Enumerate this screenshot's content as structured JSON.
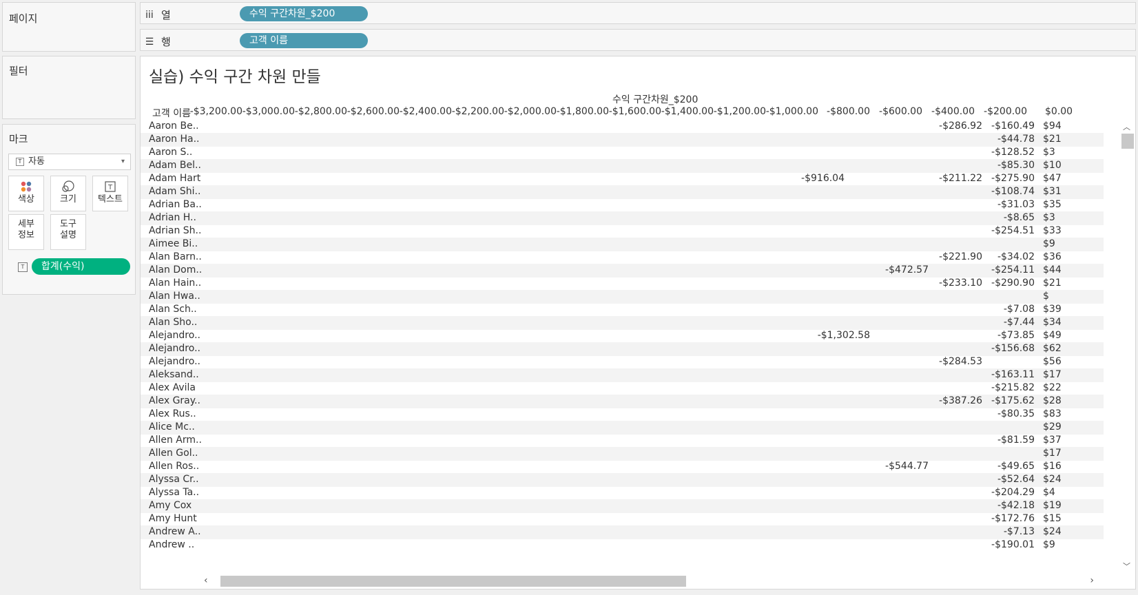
{
  "left_panel": {
    "pages_title": "페이지",
    "filters_title": "필터",
    "marks_title": "마크",
    "mark_type": "자동",
    "buttons": {
      "color": "색상",
      "size": "크기",
      "text": "텍스트",
      "detail_1": "세부",
      "detail_2": "정보",
      "tooltip_1": "도구",
      "tooltip_2": "설명"
    },
    "text_pill": "합계(수익)"
  },
  "shelves": {
    "columns_label": "열",
    "columns_pill": "수익 구간차원_$200",
    "rows_label": "행",
    "rows_pill": "고객 이름"
  },
  "view": {
    "title": "실습) 수익 구간 차원 만들",
    "column_header_title": "수익 구간차원_$200",
    "row_header_label": "고객 이름",
    "columns": [
      "-$3,200.00",
      "-$3,000.00",
      "-$2,800.00",
      "-$2,600.00",
      "-$2,400.00",
      "-$2,200.00",
      "-$2,000.00",
      "-$1,800.00",
      "-$1,600.00",
      "-$1,400.00",
      "-$1,200.00",
      "-$1,000.00",
      "-$800.00",
      "-$600.00",
      "-$400.00",
      "-$200.00",
      "$0.00"
    ],
    "rows": [
      {
        "name": "Aaron Be..",
        "cells": {
          "-$400.00": "-$286.92",
          "-$200.00": "-$160.49",
          "$0.00": "$94"
        }
      },
      {
        "name": "Aaron Ha..",
        "cells": {
          "-$200.00": "-$44.78",
          "$0.00": "$21"
        }
      },
      {
        "name": "Aaron S..",
        "cells": {
          "-$200.00": "-$128.52",
          "$0.00": "$3"
        }
      },
      {
        "name": "Adam Bel..",
        "cells": {
          "-$200.00": "-$85.30",
          "$0.00": "$10"
        }
      },
      {
        "name": "Adam Hart",
        "cells": {
          "-$1,000.00": "-$916.04",
          "-$400.00": "-$211.22",
          "-$200.00": "-$275.90",
          "$0.00": "$47"
        }
      },
      {
        "name": "Adam Shi..",
        "cells": {
          "-$200.00": "-$108.74",
          "$0.00": "$31"
        }
      },
      {
        "name": "Adrian Ba..",
        "cells": {
          "-$200.00": "-$31.03",
          "$0.00": "$35"
        }
      },
      {
        "name": "Adrian H..",
        "cells": {
          "-$200.00": "-$8.65",
          "$0.00": "$3"
        }
      },
      {
        "name": "Adrian Sh..",
        "cells": {
          "-$200.00": "-$254.51",
          "$0.00": "$33"
        }
      },
      {
        "name": "Aimee Bi..",
        "cells": {
          "$0.00": "$9"
        }
      },
      {
        "name": "Alan Barn..",
        "cells": {
          "-$400.00": "-$221.90",
          "-$200.00": "-$34.02",
          "$0.00": "$36"
        }
      },
      {
        "name": "Alan Dom..",
        "cells": {
          "-$600.00": "-$472.57",
          "-$200.00": "-$254.11",
          "$0.00": "$44"
        }
      },
      {
        "name": "Alan Hain..",
        "cells": {
          "-$400.00": "-$233.10",
          "-$200.00": "-$290.90",
          "$0.00": "$21"
        }
      },
      {
        "name": "Alan Hwa..",
        "cells": {
          "$0.00": "$"
        }
      },
      {
        "name": "Alan Sch..",
        "cells": {
          "-$200.00": "-$7.08",
          "$0.00": "$39"
        }
      },
      {
        "name": "Alan Sho..",
        "cells": {
          "-$200.00": "-$7.44",
          "$0.00": "$34"
        }
      },
      {
        "name": "Alejandro..",
        "cells": {
          "-$1,000.00": "-$1,302.58",
          "-$200.00": "-$73.85",
          "$0.00": "$49"
        }
      },
      {
        "name": "Alejandro..",
        "cells": {
          "-$200.00": "-$156.68",
          "$0.00": "$62"
        }
      },
      {
        "name": "Alejandro..",
        "cells": {
          "-$400.00": "-$284.53",
          "$0.00": "$56"
        }
      },
      {
        "name": "Aleksand..",
        "cells": {
          "-$200.00": "-$163.11",
          "$0.00": "$17"
        }
      },
      {
        "name": "Alex Avila",
        "cells": {
          "-$200.00": "-$215.82",
          "$0.00": "$22"
        }
      },
      {
        "name": "Alex Gray..",
        "cells": {
          "-$400.00": "-$387.26",
          "-$200.00": "-$175.62",
          "$0.00": "$28"
        }
      },
      {
        "name": "Alex Rus..",
        "cells": {
          "-$200.00": "-$80.35",
          "$0.00": "$83"
        }
      },
      {
        "name": "Alice Mc..",
        "cells": {
          "$0.00": "$29"
        }
      },
      {
        "name": "Allen Arm..",
        "cells": {
          "-$200.00": "-$81.59",
          "$0.00": "$37"
        }
      },
      {
        "name": "Allen Gol..",
        "cells": {
          "$0.00": "$17"
        }
      },
      {
        "name": "Allen Ros..",
        "cells": {
          "-$600.00": "-$544.77",
          "-$200.00": "-$49.65",
          "$0.00": "$16"
        }
      },
      {
        "name": "Alyssa Cr..",
        "cells": {
          "-$200.00": "-$52.64",
          "$0.00": "$24"
        }
      },
      {
        "name": "Alyssa Ta..",
        "cells": {
          "-$200.00": "-$204.29",
          "$0.00": "$4"
        }
      },
      {
        "name": "Amy Cox",
        "cells": {
          "-$200.00": "-$42.18",
          "$0.00": "$19"
        }
      },
      {
        "name": "Amy Hunt",
        "cells": {
          "-$200.00": "-$172.76",
          "$0.00": "$15"
        }
      },
      {
        "name": "Andrew A..",
        "cells": {
          "-$200.00": "-$7.13",
          "$0.00": "$24"
        }
      },
      {
        "name": "Andrew ..",
        "cells": {
          "-$200.00": "-$190.01",
          "$0.00": "$9"
        }
      }
    ]
  },
  "colors": {
    "dimension_pill": "#4b9ab1",
    "measure_pill": "#00b180"
  }
}
